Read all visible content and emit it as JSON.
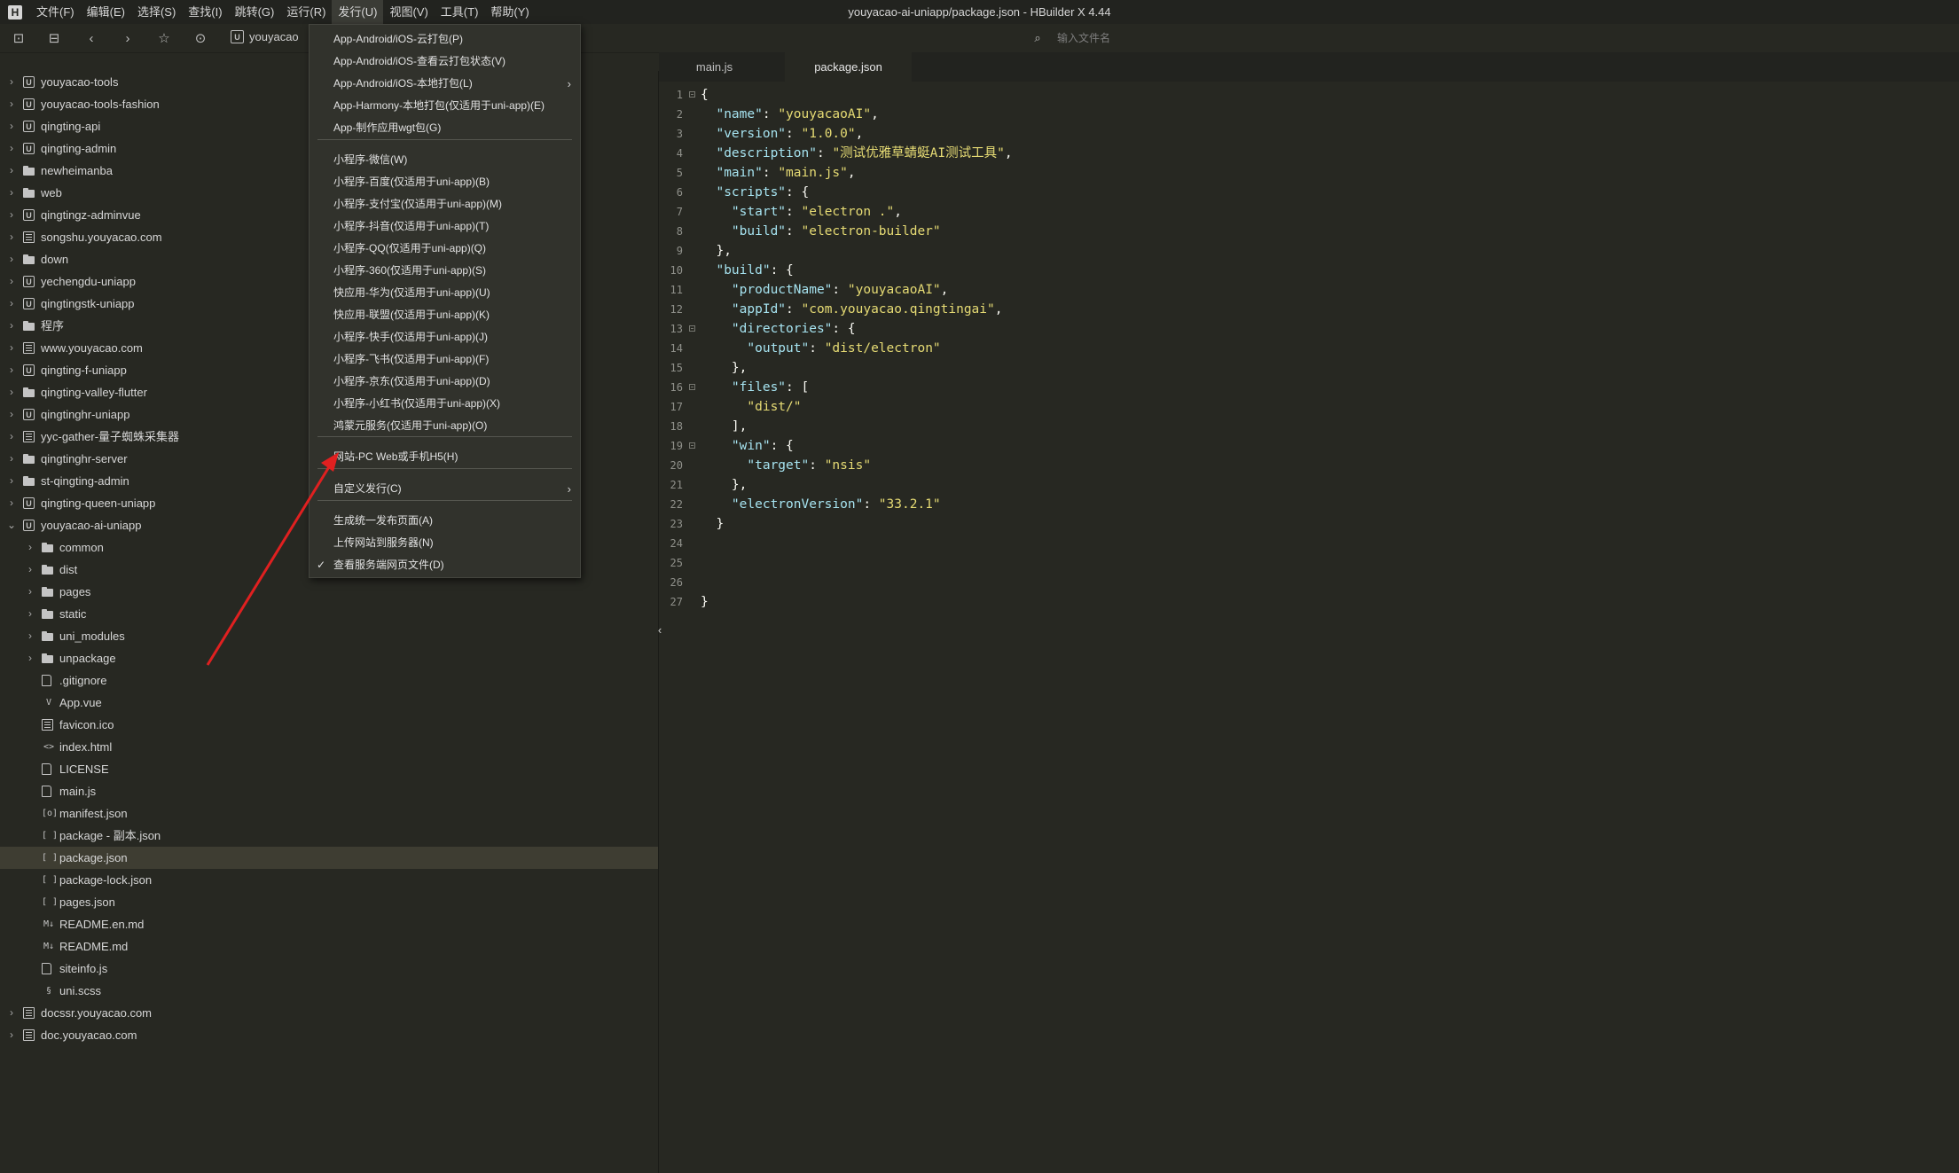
{
  "menubar": {
    "items": [
      "文件(F)",
      "编辑(E)",
      "选择(S)",
      "查找(I)",
      "跳转(G)",
      "运行(R)",
      "发行(U)",
      "视图(V)",
      "工具(T)",
      "帮助(Y)"
    ],
    "active_index": 6
  },
  "window_title": "youyacao-ai-uniapp/package.json - HBuilder X 4.44",
  "toolbar": {
    "breadcrumb": "youyacao",
    "file_search_placeholder": "输入文件名"
  },
  "tabs": [
    "main.js",
    "package.json"
  ],
  "active_tab": 1,
  "dropdown": {
    "items": [
      {
        "label": "App-Android/iOS-云打包(P)"
      },
      {
        "label": "App-Android/iOS-查看云打包状态(V)"
      },
      {
        "label": "App-Android/iOS-本地打包(L)",
        "submenu": true
      },
      {
        "label": "App-Harmony-本地打包(仅适用于uni-app)(E)"
      },
      {
        "label": "App-制作应用wgt包(G)"
      },
      {
        "label": "小程序-微信(W)"
      },
      {
        "label": "小程序-百度(仅适用于uni-app)(B)"
      },
      {
        "label": "小程序-支付宝(仅适用于uni-app)(M)"
      },
      {
        "label": "小程序-抖音(仅适用于uni-app)(T)"
      },
      {
        "label": "小程序-QQ(仅适用于uni-app)(Q)"
      },
      {
        "label": "小程序-360(仅适用于uni-app)(S)"
      },
      {
        "label": "快应用-华为(仅适用于uni-app)(U)"
      },
      {
        "label": "快应用-联盟(仅适用于uni-app)(K)"
      },
      {
        "label": "小程序-快手(仅适用于uni-app)(J)"
      },
      {
        "label": "小程序-飞书(仅适用于uni-app)(F)"
      },
      {
        "label": "小程序-京东(仅适用于uni-app)(D)"
      },
      {
        "label": "小程序-小红书(仅适用于uni-app)(X)"
      },
      {
        "label": "鸿蒙元服务(仅适用于uni-app)(O)"
      },
      {
        "label": "网站-PC Web或手机H5(H)"
      },
      {
        "label": "自定义发行(C)",
        "submenu": true
      },
      {
        "label": "生成统一发布页面(A)"
      },
      {
        "label": "上传网站到服务器(N)"
      },
      {
        "label": "查看服务端网页文件(D)",
        "checked": true
      }
    ],
    "check_symbol": "✓",
    "submenu_symbol": "›"
  },
  "tree": [
    {
      "label": "youyacao-tools",
      "icon": "u",
      "depth": 0,
      "chev": "›"
    },
    {
      "label": "youyacao-tools-fashion",
      "icon": "u",
      "depth": 0,
      "chev": "›"
    },
    {
      "label": "qingting-api",
      "icon": "u",
      "depth": 0,
      "chev": "›"
    },
    {
      "label": "qingting-admin",
      "icon": "u",
      "depth": 0,
      "chev": "›"
    },
    {
      "label": "newheimanba",
      "icon": "folder",
      "depth": 0,
      "chev": "›"
    },
    {
      "label": "web",
      "icon": "folder",
      "depth": 0,
      "chev": "›"
    },
    {
      "label": "qingtingz-adminvue",
      "icon": "u",
      "depth": 0,
      "chev": "›"
    },
    {
      "label": "songshu.youyacao.com",
      "icon": "web",
      "depth": 0,
      "chev": "›"
    },
    {
      "label": "down",
      "icon": "folder",
      "depth": 0,
      "chev": "›"
    },
    {
      "label": "yechengdu-uniapp",
      "icon": "u",
      "depth": 0,
      "chev": "›"
    },
    {
      "label": "qingtingstk-uniapp",
      "icon": "u",
      "depth": 0,
      "chev": "›"
    },
    {
      "label": "程序",
      "icon": "folder",
      "depth": 0,
      "chev": "›"
    },
    {
      "label": "www.youyacao.com",
      "icon": "web",
      "depth": 0,
      "chev": "›"
    },
    {
      "label": "qingting-f-uniapp",
      "icon": "u",
      "depth": 0,
      "chev": "›"
    },
    {
      "label": "qingting-valley-flutter",
      "icon": "folder",
      "depth": 0,
      "chev": "›"
    },
    {
      "label": "qingtinghr-uniapp",
      "icon": "u",
      "depth": 0,
      "chev": "›"
    },
    {
      "label": "yyc-gather-量子蜘蛛采集器",
      "icon": "web",
      "depth": 0,
      "chev": "›"
    },
    {
      "label": "qingtinghr-server",
      "icon": "folder",
      "depth": 0,
      "chev": "›"
    },
    {
      "label": "st-qingting-admin",
      "icon": "folder",
      "depth": 0,
      "chev": "›"
    },
    {
      "label": "qingting-queen-uniapp",
      "icon": "u",
      "depth": 0,
      "chev": "›"
    },
    {
      "label": "youyacao-ai-uniapp",
      "icon": "u",
      "depth": 0,
      "chev": "⌄"
    },
    {
      "label": "common",
      "icon": "folder",
      "depth": 1,
      "chev": "›"
    },
    {
      "label": "dist",
      "icon": "folder",
      "depth": 1,
      "chev": "›"
    },
    {
      "label": "pages",
      "icon": "folder",
      "depth": 1,
      "chev": "›"
    },
    {
      "label": "static",
      "icon": "folder",
      "depth": 1,
      "chev": "›"
    },
    {
      "label": "uni_modules",
      "icon": "folder",
      "depth": 1,
      "chev": "›"
    },
    {
      "label": "unpackage",
      "icon": "folder",
      "depth": 1,
      "chev": "›"
    },
    {
      "label": ".gitignore",
      "icon": "file",
      "depth": 1
    },
    {
      "label": "App.vue",
      "icon": "V",
      "depth": 1
    },
    {
      "label": "favicon.ico",
      "icon": "img",
      "depth": 1
    },
    {
      "label": "index.html",
      "icon": "<>",
      "depth": 1
    },
    {
      "label": "LICENSE",
      "icon": "file",
      "depth": 1
    },
    {
      "label": "main.js",
      "icon": "file",
      "depth": 1
    },
    {
      "label": "manifest.json",
      "icon": "[o]",
      "depth": 1
    },
    {
      "label": "package - 副本.json",
      "icon": "[ ]",
      "depth": 1
    },
    {
      "label": "package.json",
      "icon": "[ ]",
      "depth": 1,
      "selected": true
    },
    {
      "label": "package-lock.json",
      "icon": "[ ]",
      "depth": 1
    },
    {
      "label": "pages.json",
      "icon": "[ ]",
      "depth": 1
    },
    {
      "label": "README.en.md",
      "icon": "M↓",
      "depth": 1
    },
    {
      "label": "README.md",
      "icon": "M↓",
      "depth": 1
    },
    {
      "label": "siteinfo.js",
      "icon": "file",
      "depth": 1
    },
    {
      "label": "uni.scss",
      "icon": "§",
      "depth": 1
    },
    {
      "label": "docssr.youyacao.com",
      "icon": "web",
      "depth": 0,
      "chev": "›"
    },
    {
      "label": "doc.youyacao.com",
      "icon": "web",
      "depth": 0,
      "chev": "›"
    }
  ],
  "code": {
    "lines": [
      [
        [
          "p",
          "{"
        ]
      ],
      [
        [
          "p",
          "  "
        ],
        [
          "k",
          "\"name\""
        ],
        [
          "p",
          ": "
        ],
        [
          "s",
          "\"youyacaoAI\""
        ],
        [
          "p",
          ","
        ]
      ],
      [
        [
          "p",
          "  "
        ],
        [
          "k",
          "\"version\""
        ],
        [
          "p",
          ": "
        ],
        [
          "s",
          "\"1.0.0\""
        ],
        [
          "p",
          ","
        ]
      ],
      [
        [
          "p",
          "  "
        ],
        [
          "k",
          "\"description\""
        ],
        [
          "p",
          ": "
        ],
        [
          "s",
          "\"测试优雅草蜻蜓AI测试工具\""
        ],
        [
          "p",
          ","
        ]
      ],
      [
        [
          "p",
          "  "
        ],
        [
          "k",
          "\"main\""
        ],
        [
          "p",
          ": "
        ],
        [
          "s",
          "\"main.js\""
        ],
        [
          "p",
          ","
        ]
      ],
      [
        [
          "p",
          "  "
        ],
        [
          "k",
          "\"scripts\""
        ],
        [
          "p",
          ": {"
        ]
      ],
      [
        [
          "p",
          "    "
        ],
        [
          "k",
          "\"start\""
        ],
        [
          "p",
          ": "
        ],
        [
          "s",
          "\"electron .\""
        ],
        [
          "p",
          ","
        ]
      ],
      [
        [
          "p",
          "    "
        ],
        [
          "k",
          "\"build\""
        ],
        [
          "p",
          ": "
        ],
        [
          "s",
          "\"electron-builder\""
        ]
      ],
      [
        [
          "p",
          "  },"
        ]
      ],
      [
        [
          "p",
          "  "
        ],
        [
          "k",
          "\"build\""
        ],
        [
          "p",
          ": {"
        ]
      ],
      [
        [
          "p",
          "    "
        ],
        [
          "k",
          "\"productName\""
        ],
        [
          "p",
          ": "
        ],
        [
          "s",
          "\"youyacaoAI\""
        ],
        [
          "p",
          ","
        ]
      ],
      [
        [
          "p",
          "    "
        ],
        [
          "k",
          "\"appId\""
        ],
        [
          "p",
          ": "
        ],
        [
          "s",
          "\"com.youyacao.qingtingai\""
        ],
        [
          "p",
          ","
        ]
      ],
      [
        [
          "p",
          "    "
        ],
        [
          "k",
          "\"directories\""
        ],
        [
          "p",
          ": {"
        ]
      ],
      [
        [
          "p",
          "      "
        ],
        [
          "k",
          "\"output\""
        ],
        [
          "p",
          ": "
        ],
        [
          "s",
          "\"dist/electron\""
        ]
      ],
      [
        [
          "p",
          "    },"
        ]
      ],
      [
        [
          "p",
          "    "
        ],
        [
          "k",
          "\"files\""
        ],
        [
          "p",
          ": ["
        ]
      ],
      [
        [
          "p",
          "      "
        ],
        [
          "s",
          "\"dist/\""
        ]
      ],
      [
        [
          "p",
          "    ],"
        ]
      ],
      [
        [
          "p",
          "    "
        ],
        [
          "k",
          "\"win\""
        ],
        [
          "p",
          ": {"
        ]
      ],
      [
        [
          "p",
          "      "
        ],
        [
          "k",
          "\"target\""
        ],
        [
          "p",
          ": "
        ],
        [
          "s",
          "\"nsis\""
        ]
      ],
      [
        [
          "p",
          "    },"
        ]
      ],
      [
        [
          "p",
          "    "
        ],
        [
          "k",
          "\"electronVersion\""
        ],
        [
          "p",
          ": "
        ],
        [
          "s",
          "\"33.2.1\""
        ]
      ],
      [
        [
          "p",
          "  }"
        ]
      ],
      [],
      [],
      [],
      [
        [
          "p",
          "}"
        ]
      ]
    ],
    "fold_lines": [
      1,
      13,
      16,
      19
    ]
  },
  "colors": {
    "background": "#272822",
    "menu_bg": "#31322c",
    "string": "#e6db74",
    "key": "#a6e3f0",
    "annotation_arrow": "#e02020"
  }
}
